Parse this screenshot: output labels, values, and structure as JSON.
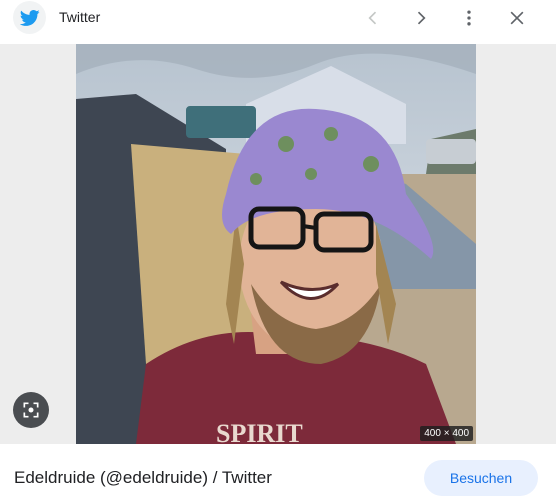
{
  "header": {
    "site_logo_icon": "twitter-bird-icon",
    "site_name": "Twitter",
    "prev_icon": "chevron-left-icon",
    "next_icon": "chevron-right-icon",
    "more_icon": "more-vert-icon",
    "close_icon": "close-icon"
  },
  "image": {
    "size_label": "400 × 400",
    "shirt_text": "SPIRIT"
  },
  "lens": {
    "icon": "lens-search-icon"
  },
  "footer": {
    "title": "Edeldruide (@edeldruide) / Twitter",
    "visit_label": "Besuchen"
  },
  "colors": {
    "twitter_blue": "#1d9bf0",
    "accent": "#1a73e8",
    "button_bg": "#e8f0fe"
  }
}
